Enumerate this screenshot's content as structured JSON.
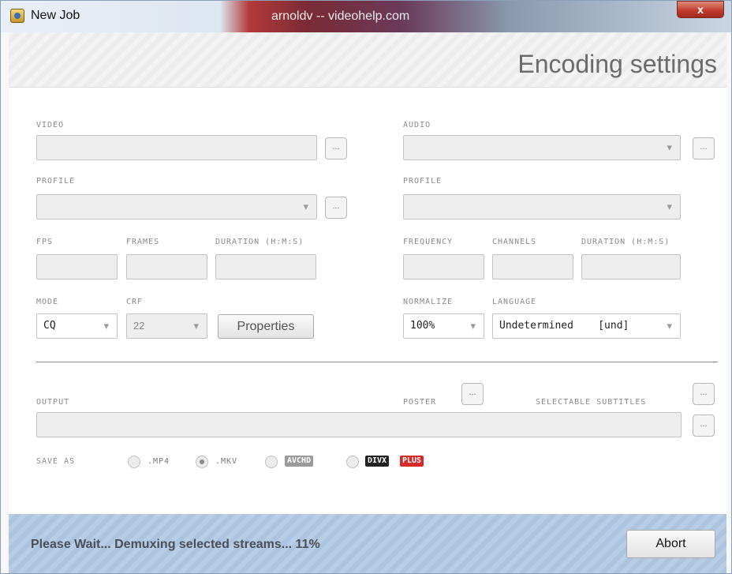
{
  "window": {
    "title": "New Job",
    "watermark": "arnoldv -- videohelp.com",
    "close_label": "x"
  },
  "header": {
    "title": "Encoding settings"
  },
  "video": {
    "label": "VIDEO",
    "file_value": "",
    "profile_label": "PROFILE",
    "profile_value": "",
    "fps_label": "FPS",
    "frames_label": "FRAMES",
    "duration_label": "DURATION (H:M:S)",
    "fps_value": "",
    "frames_value": "",
    "duration_value": "",
    "mode_label": "MODE",
    "mode_value": "CQ",
    "crf_label": "CRF",
    "crf_value": "22",
    "properties_label": "Properties"
  },
  "audio": {
    "label": "AUDIO",
    "track_value": "",
    "profile_label": "PROFILE",
    "profile_value": "",
    "frequency_label": "FREQUENCY",
    "channels_label": "CHANNELS",
    "duration_label": "DURATION (H:M:S)",
    "frequency_value": "",
    "channels_value": "",
    "duration_value": "",
    "normalize_label": "NORMALIZE",
    "normalize_value": "100%",
    "language_label": "LANGUAGE",
    "language_value": "Undetermined    [und]"
  },
  "output": {
    "label": "OUTPUT",
    "value": "",
    "poster_label": "POSTER",
    "subtitles_label": "SELECTABLE SUBTITLES",
    "browse_label": "...",
    "save_as_label": "SAVE AS",
    "formats": [
      {
        "label": ".MP4",
        "checked": false
      },
      {
        "label": ".MKV",
        "checked": true
      },
      {
        "label": "AVCHD",
        "checked": false
      },
      {
        "label_a": "DIVX",
        "label_b": "PLUS",
        "checked": false
      }
    ]
  },
  "footer": {
    "status": "Please Wait... Demuxing selected streams... 11%",
    "abort_label": "Abort"
  },
  "colors": {
    "accent_footer": "#b8cde6",
    "divx_plus_red": "#d42a2a"
  }
}
